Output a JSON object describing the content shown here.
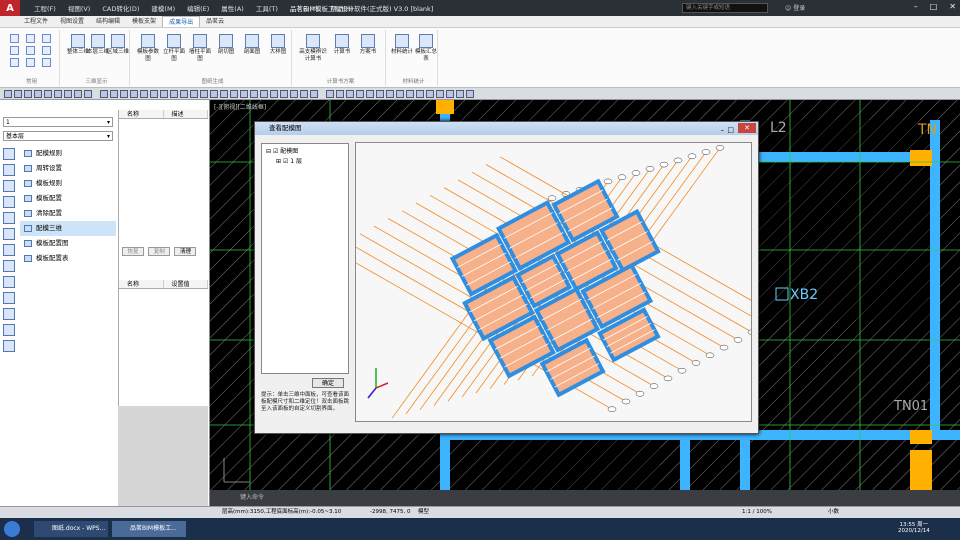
{
  "titlebar": {
    "logo": "A",
    "menus": [
      "工程(F)",
      "视图(V)",
      "CAD转化(D)",
      "建模(M)",
      "编辑(E)",
      "属性(A)",
      "工具(T)",
      "品茗云(Y)",
      "帮助(H)"
    ],
    "title": "品茗BIM模板工程设计软件(正式版) V3.0   [blank]",
    "search_placeholder": "键入关键字或短语",
    "user": "登录"
  },
  "ribbon_tabs": [
    "工程文件",
    "视图设置",
    "结构编辑",
    "模板支架",
    "成果导出",
    "品茗云"
  ],
  "active_tab": "成果导出",
  "ribbon_groups": [
    {
      "label": "常用",
      "buttons": []
    },
    {
      "label": "三维显示",
      "buttons": [
        "整体三维",
        "本层三维",
        "区域三维"
      ]
    },
    {
      "label": "图纸生成",
      "buttons": [
        "模板参数图",
        "立杆平面图",
        "墙柱平面图",
        "剖切图",
        "剖面图",
        "大样图"
      ]
    },
    {
      "label": "计算书方案",
      "buttons": [
        "高支模辨识计算书",
        "计算书",
        "方案书"
      ]
    },
    {
      "label": "材料统计",
      "buttons": [
        "材料统计",
        "模板汇总表"
      ]
    }
  ],
  "left_panel": {
    "floor_select": "1",
    "layer_select": "基本层",
    "commands": [
      "配模规则",
      "周转设置",
      "模板规则",
      "模板配置",
      "清除配置",
      "配模三维",
      "模板配置图",
      "模板配置表"
    ],
    "selected_command": "配模三维"
  },
  "prop_panel": {
    "header1": [
      "名称",
      "描述"
    ],
    "buttons": [
      "恢复",
      "复制",
      "清理"
    ],
    "header2": [
      "名称",
      "设置值"
    ]
  },
  "canvas": {
    "view_label": "[-][俯视][二维线框]",
    "labels": [
      "L2",
      "TN",
      "XB2",
      "TN01"
    ]
  },
  "dialog": {
    "title": "查看配模图",
    "tree_root": "配模图",
    "tree_child": "1 层",
    "confirm": "确定",
    "hint": "提示：单击三维中面板，可查看该面板配模尺寸和二维定位！双击面板跳至入该面板的自定义切割界面。"
  },
  "command_line": {
    "prompt": "键入命令"
  },
  "statusbar": {
    "elevation": "层高(mm):3150,工程底面标高(m):-0.05~3.10",
    "coords": "-2998, 7475, 0",
    "model": "模型",
    "scale": "1:1 / 100%",
    "units": "小数"
  },
  "taskbar": {
    "items": [
      "图纸.docx - WPS...",
      "品茗BIM模板工..."
    ],
    "time": "13:55 周一",
    "date": "2020/12/14"
  },
  "colors": {
    "accent": "#1a5fb4",
    "beam": "#00b4ff",
    "column": "#ffb400",
    "grid": "#2ecc40"
  }
}
